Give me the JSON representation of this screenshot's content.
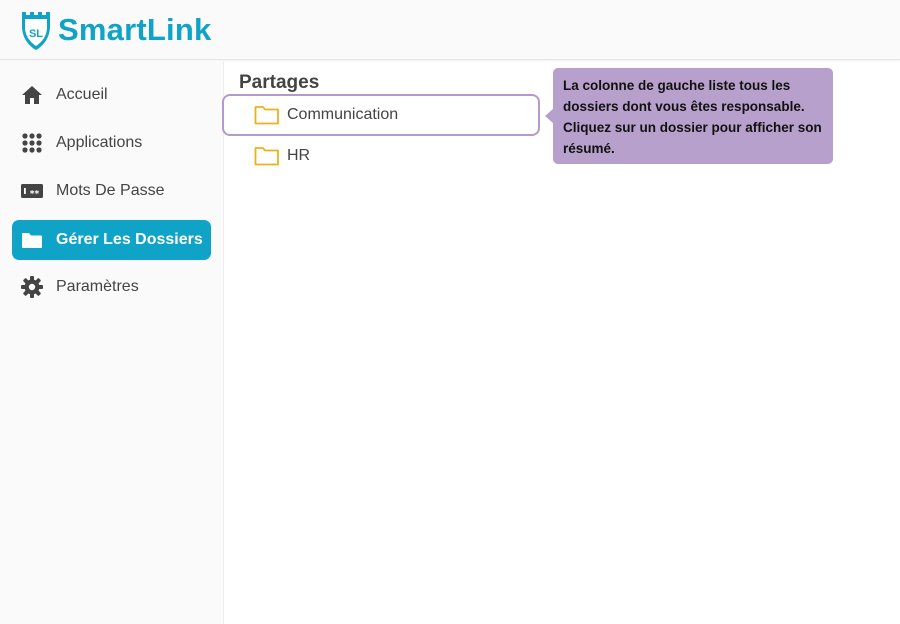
{
  "app": {
    "logo_text": "SL",
    "brand": "SmartLink",
    "brand_color": "#0fa3c8"
  },
  "sidebar": {
    "items": [
      {
        "label": "Accueil",
        "icon": "home-icon",
        "active": false
      },
      {
        "label": "Applications",
        "icon": "grid-icon",
        "active": false
      },
      {
        "label": "Mots De Passe",
        "icon": "password-icon",
        "active": false
      },
      {
        "label": "Gérer Les Dossiers",
        "icon": "folder-icon",
        "active": true
      },
      {
        "label": "Paramètres",
        "icon": "gear-icon",
        "active": false
      }
    ]
  },
  "main": {
    "section_title": "Partages",
    "folders": [
      {
        "name": "Communication",
        "selected": true
      },
      {
        "name": "HR",
        "selected": false
      }
    ]
  },
  "tooltip": {
    "text": "La colonne de gauche liste tous les dossiers dont vous êtes responsable. Cliquez sur un dossier pour afficher son résumé."
  },
  "colors": {
    "accent": "#0fa3c8",
    "tooltip_bg": "#b7a0cc",
    "selection_border": "#b49acb",
    "folder_icon": "#e8b21c"
  }
}
